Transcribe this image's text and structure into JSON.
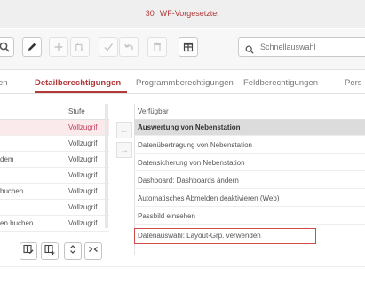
{
  "window": {
    "number": "30",
    "title": "WF-Vorgesetzter"
  },
  "toolbar": {
    "buttons": [
      {
        "icon": "search-icon"
      },
      {
        "icon": "pencil-icon"
      },
      {
        "icon": "plus-icon"
      },
      {
        "icon": "copy-icon"
      },
      {
        "icon": "check-icon"
      },
      {
        "icon": "undo-icon"
      },
      {
        "icon": "trash-icon"
      },
      {
        "icon": "grid-icon"
      }
    ],
    "search": {
      "placeholder": "Schnellauswahl",
      "value": ""
    }
  },
  "tabs": [
    {
      "label": "en",
      "active": false
    },
    {
      "label": "Detailberechtigungen",
      "active": true
    },
    {
      "label": "Programmberechtigungen",
      "active": false
    },
    {
      "label": "Feldberechtigungen",
      "active": false
    },
    {
      "label": "Pers",
      "active": false
    }
  ],
  "left_table": {
    "columns": [
      "",
      "Stufe"
    ],
    "rows": [
      {
        "name": "",
        "stufe": "Vollzugrif",
        "selected": true
      },
      {
        "name": "",
        "stufe": "Vollzugrif",
        "selected": false
      },
      {
        "name": "dem",
        "stufe": "Vollzugrif",
        "selected": false
      },
      {
        "name": "",
        "stufe": "Vollzugrif",
        "selected": false
      },
      {
        "name": " buchen",
        "stufe": "Vollzugrif",
        "selected": false
      },
      {
        "name": "",
        "stufe": "Vollzugrif",
        "selected": false
      },
      {
        "name": "en buchen",
        "stufe": "Vollzugrif",
        "selected": false
      }
    ]
  },
  "transfer": {
    "left_arrow": "←",
    "right_arrow": "→"
  },
  "available_list": {
    "header": "Verfügbar",
    "items": [
      {
        "label": "Auswertung von Nebenstation",
        "selected": true,
        "boxed": false
      },
      {
        "label": "Datenübertragung von Nebenstation",
        "selected": false,
        "boxed": false
      },
      {
        "label": "Datensicherung von Nebenstation",
        "selected": false,
        "boxed": false
      },
      {
        "label": "Dashboard: Dashboards ändern",
        "selected": false,
        "boxed": false
      },
      {
        "label": "Automatisches Abmelden deaktivieren (Web)",
        "selected": false,
        "boxed": false
      },
      {
        "label": "Passbild einsehen",
        "selected": false,
        "boxed": false
      },
      {
        "label": "Datenauswahl: Layout-Grp. verwenden",
        "selected": false,
        "boxed": true
      }
    ]
  },
  "bottom_buttons": [
    {
      "icon": "table-edit-icon"
    },
    {
      "icon": "table-add-icon"
    },
    {
      "icon": "expand-vertical-icon"
    },
    {
      "icon": "collapse-horizontal-icon"
    }
  ],
  "colors": {
    "accent": "#b13a3a",
    "selected_row_bg": "#fbeaec",
    "highlight_box": "#d24b4b"
  }
}
